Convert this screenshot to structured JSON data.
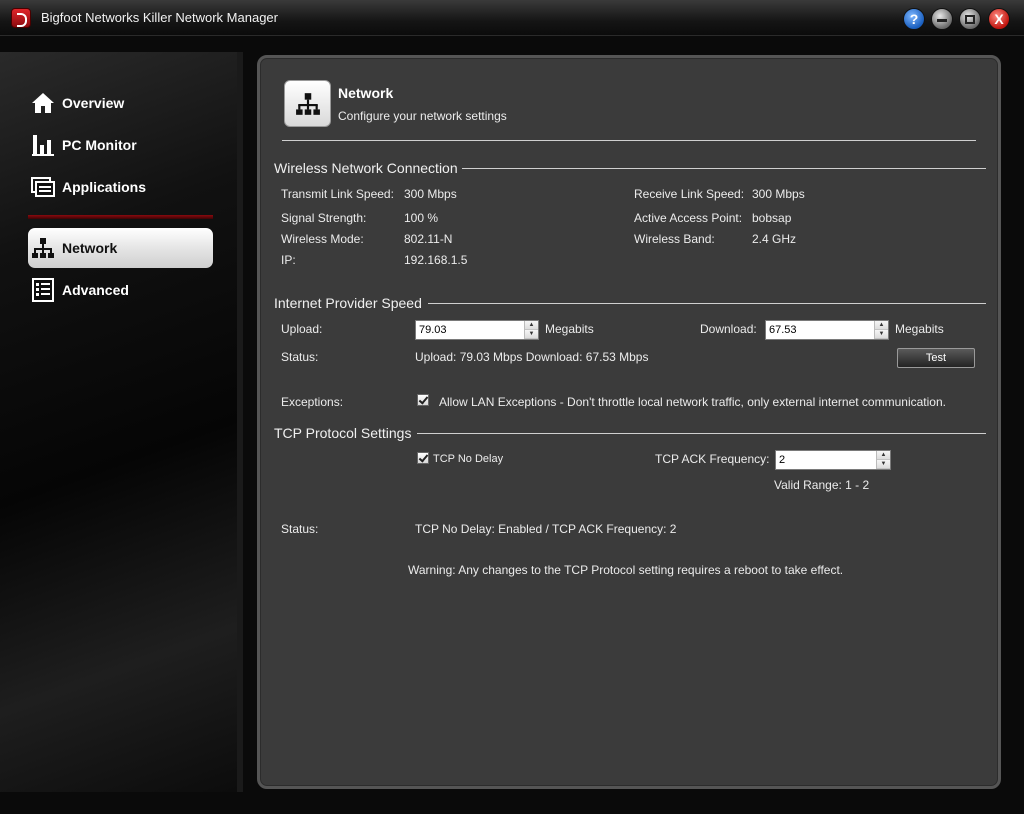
{
  "window": {
    "title": "Bigfoot Networks Killer Network Manager",
    "help_glyph": "?",
    "close_glyph": "X"
  },
  "sidebar": {
    "items": [
      {
        "label": "Overview",
        "icon": "home-icon"
      },
      {
        "label": "PC Monitor",
        "icon": "bar-chart-icon"
      },
      {
        "label": "Applications",
        "icon": "applications-icon"
      },
      {
        "label": "Network",
        "icon": "network-icon",
        "active": true
      },
      {
        "label": "Advanced",
        "icon": "advanced-list-icon"
      }
    ]
  },
  "header": {
    "title": "Network",
    "subtitle": "Configure your network settings"
  },
  "wireless": {
    "section_title": "Wireless Network Connection",
    "transmit_label": "Transmit Link Speed:",
    "transmit_value": "300  Mbps",
    "signal_label": "Signal Strength:",
    "signal_value": "100 %",
    "mode_label": "Wireless Mode:",
    "mode_value": "802.11-N",
    "ip_label": "IP:",
    "ip_value": "192.168.1.5",
    "receive_label": "Receive Link Speed:",
    "receive_value": "300  Mbps",
    "ap_label": "Active Access Point:",
    "ap_value": "bobsap",
    "band_label": "Wireless Band:",
    "band_value": "2.4 GHz"
  },
  "speed": {
    "section_title": "Internet Provider Speed",
    "upload_label": "Upload:",
    "upload_value": "79.03",
    "upload_unit": "Megabits",
    "download_label": "Download:",
    "download_value": "67.53",
    "download_unit": "Megabits",
    "status_label": "Status:",
    "status_value": "Upload: 79.03 Mbps Download: 67.53 Mbps",
    "test_label": "Test",
    "exceptions_label": "Exceptions:",
    "exceptions_text": "Allow LAN Exceptions - Don't throttle local network traffic, only external internet communication."
  },
  "tcp": {
    "section_title": "TCP Protocol Settings",
    "nodelay_label": "TCP No Delay",
    "ack_label": "TCP ACK Frequency:",
    "ack_value": "2",
    "valid_range": "Valid Range: 1 - 2",
    "status_label": "Status:",
    "status_value": "TCP No Delay: Enabled / TCP ACK Frequency: 2",
    "warning": "Warning: Any changes to the TCP Protocol setting requires a reboot to take effect."
  }
}
